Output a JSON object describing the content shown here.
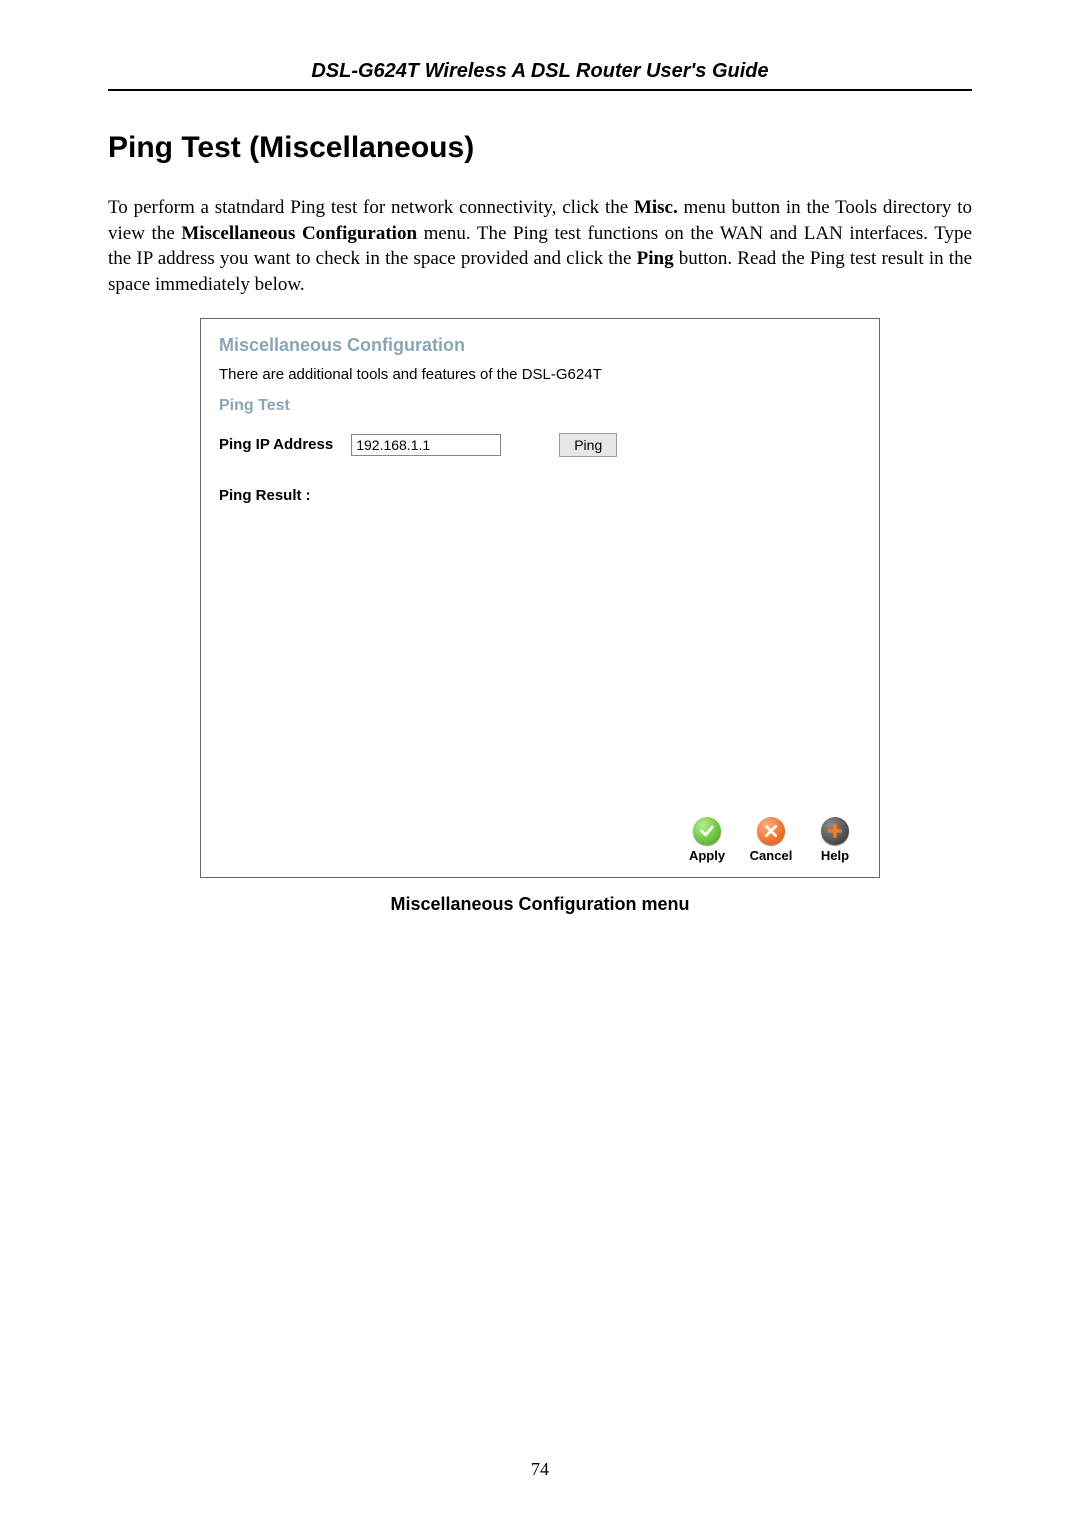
{
  "doc": {
    "header": "DSL-G624T Wireless A DSL Router User's Guide",
    "section_title": "Ping Test (Miscellaneous)",
    "paragraph": {
      "p1a": "To perform a statndard Ping test for network connectivity, click the ",
      "b1": "Misc.",
      "p1b": " menu button in the Tools directory to view the ",
      "b2": "Miscellaneous Configuration",
      "p1c": " menu. The Ping test functions on the WAN and LAN interfaces. Type the IP address you want to check in the space provided and click the ",
      "b3": "Ping",
      "p1d": " button. Read the Ping test result in the space immediately below."
    },
    "caption": "Miscellaneous Configuration menu",
    "page_number": "74"
  },
  "panel": {
    "title": "Miscellaneous Configuration",
    "desc": "There are additional tools and features of the DSL-G624T",
    "ping_title": "Ping Test",
    "ping_label": "Ping IP Address",
    "ip_value": "192.168.1.1",
    "ping_button": "Ping",
    "result_label": "Ping Result :",
    "actions": {
      "apply": "Apply",
      "cancel": "Cancel",
      "help": "Help"
    }
  }
}
